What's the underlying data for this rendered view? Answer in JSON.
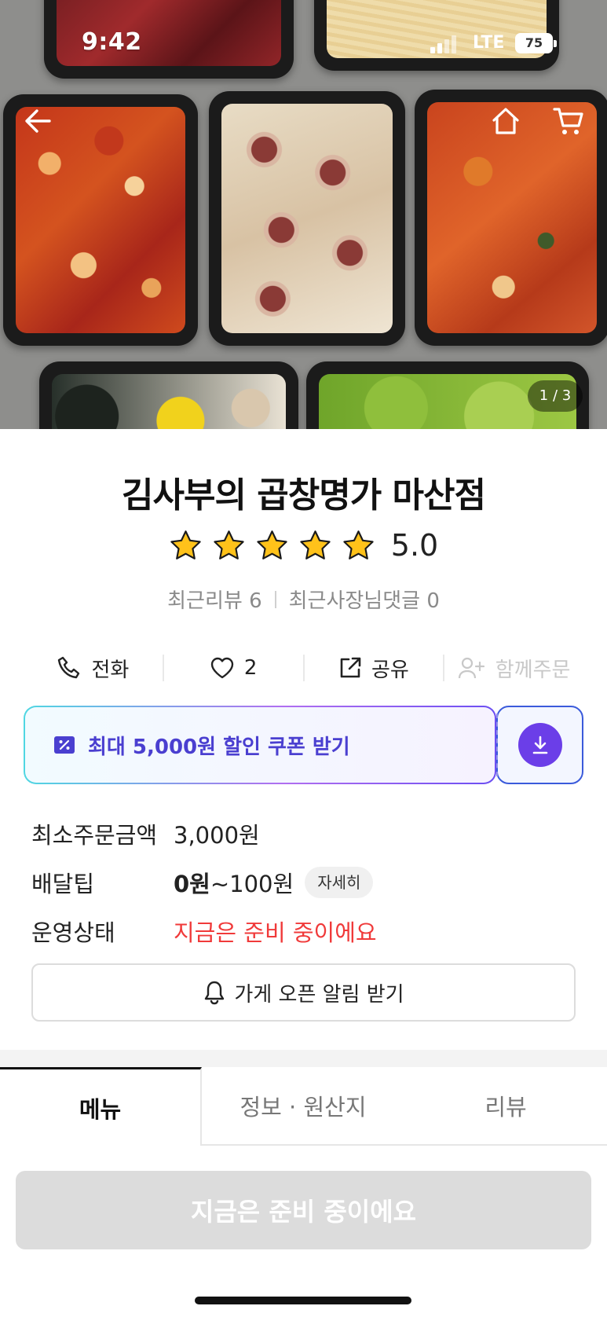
{
  "status_bar": {
    "time": "9:42",
    "network": "LTE",
    "battery": "75"
  },
  "hero": {
    "page_counter": "1 / 3",
    "icons": [
      "back-arrow-icon",
      "home-icon",
      "cart-icon"
    ]
  },
  "store": {
    "name": "김사부의 곱창명가 마산점",
    "rating": "5.0",
    "stars": 5,
    "recent_reviews": "최근리뷰 6",
    "owner_replies": "최근사장님댓글 0"
  },
  "actions": {
    "call": "전화",
    "like_count": "2",
    "share": "공유",
    "group_order": "함께주문"
  },
  "coupon": {
    "text": "최대 5,000원 할인 쿠폰 받기"
  },
  "info": {
    "min_order_label": "최소주문금액",
    "min_order_value": "3,000원",
    "delivery_tip_label": "배달팁",
    "delivery_tip_bold": "0원",
    "delivery_tip_rest": "~100원",
    "delivery_tip_detail": "자세히",
    "status_label": "운영상태",
    "status_value": "지금은 준비 중이에요"
  },
  "alarm_button": "가게 오픈 알림 받기",
  "tabs": [
    "메뉴",
    "정보 · 원산지",
    "리뷰"
  ],
  "order_button": "지금은 준비 중이에요",
  "colors": {
    "status_red": "#f03a3a",
    "coupon_purple": "#4a3fd0",
    "download_circle": "#6b3ee8",
    "disabled_button": "#dcdcdc"
  }
}
